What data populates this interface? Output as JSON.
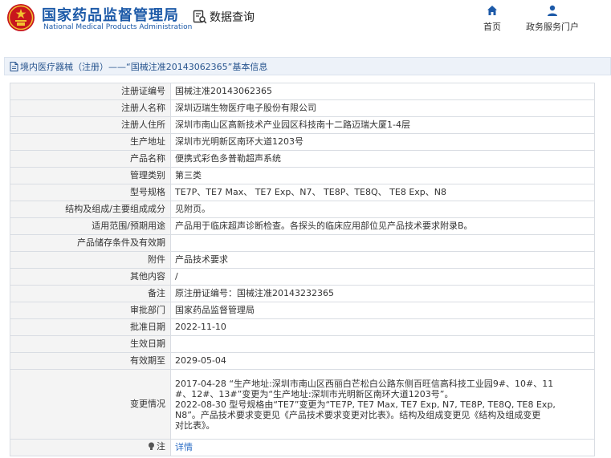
{
  "header": {
    "brand_cn": "国家药品监督管理局",
    "brand_en": "National Medical Products Administration",
    "query_label": "数据查询",
    "nav": {
      "home": "首页",
      "service": "政务服务门户"
    }
  },
  "title_bar": {
    "text": "境内医疗器械（注册）——“国械注准20143062365”基本信息"
  },
  "fields": {
    "reg_no": {
      "label": "注册证编号",
      "value": "国械注准20143062365"
    },
    "registrant": {
      "label": "注册人名称",
      "value": "深圳迈瑞生物医疗电子股份有限公司"
    },
    "registrant_addr": {
      "label": "注册人住所",
      "value": "深圳市南山区高新技术产业园区科技南十二路迈瑞大厦1-4层"
    },
    "prod_addr": {
      "label": "生产地址",
      "value": "深圳市光明新区南环大道1203号"
    },
    "product_name": {
      "label": "产品名称",
      "value": "便携式彩色多普勒超声系统"
    },
    "category": {
      "label": "管理类别",
      "value": "第三类"
    },
    "model": {
      "label": "型号规格",
      "value": "TE7P、TE7 Max、 TE7 Exp、N7、 TE8P、TE8Q、 TE8 Exp、N8"
    },
    "structure": {
      "label": "结构及组成/主要组成成分",
      "value": "见附页。"
    },
    "scope": {
      "label": "适用范围/预期用途",
      "value": "产品用于临床超声诊断检查。各探头的临床应用部位见产品技术要求附录B。"
    },
    "storage": {
      "label": "产品储存条件及有效期",
      "value": ""
    },
    "attachment": {
      "label": "附件",
      "value": "产品技术要求"
    },
    "other": {
      "label": "其他内容",
      "value": "/"
    },
    "remark": {
      "label": "备注",
      "value": "原注册证编号：国械注准20143232365"
    },
    "dept": {
      "label": "审批部门",
      "value": "国家药品监督管理局"
    },
    "approve_date": {
      "label": "批准日期",
      "value": "2022-11-10"
    },
    "effective_date": {
      "label": "生效日期",
      "value": ""
    },
    "expiry": {
      "label": "有效期至",
      "value": "2029-05-04"
    },
    "changes": {
      "label": "变更情况",
      "lines": [
        "2017-04-28 “生产地址:深圳市南山区西丽白芒松白公路东侧百旺信高科技工业园9#、10#、11",
        "#、12#、13#”变更为“生产地址:深圳市光明新区南环大道1203号”。",
        "2022-08-30 型号规格由“TE7”变更为“TE7P, TE7 Max, TE7 Exp, N7, TE8P, TE8Q, TE8 Exp,",
        "N8”。产品技术要求变更见《产品技术要求变更对比表》。结构及组成变更见《结构及组成变更",
        "对比表》。"
      ]
    },
    "note": {
      "label": "注",
      "link": "详情"
    }
  },
  "colors": {
    "brand_blue": "#1d5aa8",
    "title_bg": "#edf2f9",
    "label_bg": "#f4f4f4",
    "border": "#d9dde3",
    "link": "#2a6cc5"
  },
  "icons": {
    "logo": "emblem-logo",
    "query": "data-query-icon",
    "home": "home-icon",
    "service": "user-icon",
    "title": "document-icon",
    "note": "bulb-icon"
  }
}
